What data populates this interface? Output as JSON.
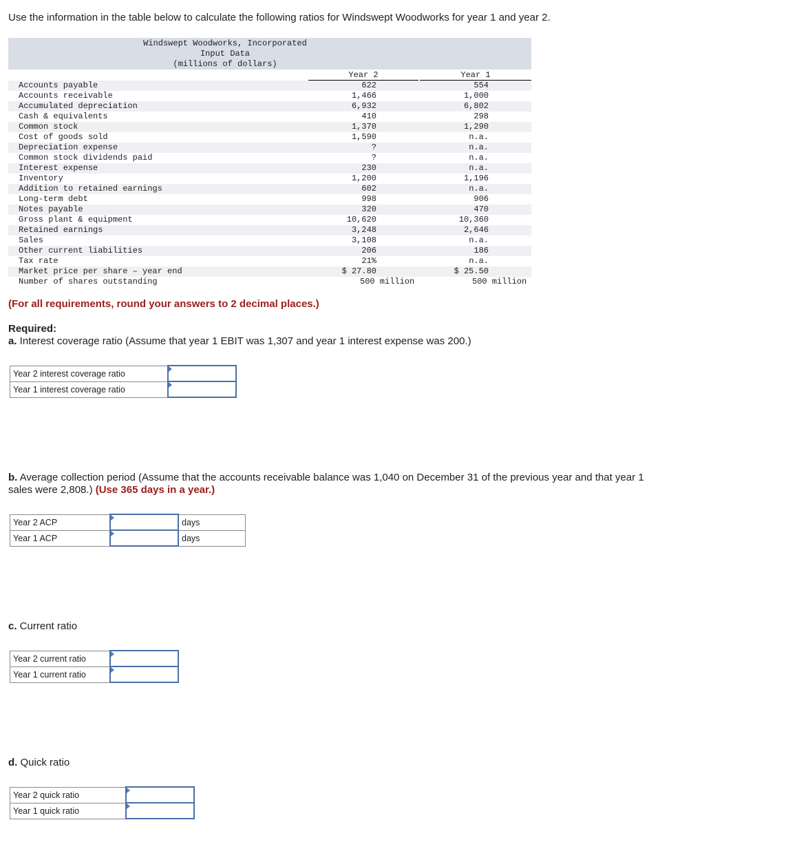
{
  "intro": "Use the information in the table below to calculate the following ratios for Windswept Woodworks for year 1 and year 2.",
  "table": {
    "title1": "Windswept Woodworks, Incorporated",
    "title2": "Input Data",
    "title3": "(millions of dollars)",
    "col_year2": "Year 2",
    "col_year1": "Year 1",
    "rows": [
      {
        "label": "Accounts payable",
        "y2": "622",
        "y1": "554"
      },
      {
        "label": "Accounts receivable",
        "y2": "1,466",
        "y1": "1,000"
      },
      {
        "label": "Accumulated depreciation",
        "y2": "6,932",
        "y1": "6,802"
      },
      {
        "label": "Cash & equivalents",
        "y2": "410",
        "y1": "298"
      },
      {
        "label": "Common stock",
        "y2": "1,370",
        "y1": "1,290"
      },
      {
        "label": "Cost of goods sold",
        "y2": "1,590",
        "y1": "n.a."
      },
      {
        "label": "Depreciation expense",
        "y2": "?",
        "y1": "n.a."
      },
      {
        "label": "Common stock dividends paid",
        "y2": "?",
        "y1": "n.a."
      },
      {
        "label": "Interest expense",
        "y2": "230",
        "y1": "n.a."
      },
      {
        "label": "Inventory",
        "y2": "1,200",
        "y1": "1,196"
      },
      {
        "label": "Addition to retained earnings",
        "y2": "602",
        "y1": "n.a."
      },
      {
        "label": "Long-term debt",
        "y2": "998",
        "y1": "906"
      },
      {
        "label": "Notes payable",
        "y2": "320",
        "y1": "470"
      },
      {
        "label": "Gross plant & equipment",
        "y2": "10,620",
        "y1": "10,360"
      },
      {
        "label": "Retained earnings",
        "y2": "3,248",
        "y1": "2,646"
      },
      {
        "label": "Sales",
        "y2": "3,108",
        "y1": "n.a."
      },
      {
        "label": "Other current liabilities",
        "y2": "206",
        "y1": "186"
      },
      {
        "label": "Tax rate",
        "y2": "21%",
        "y1": "n.a."
      },
      {
        "label": "Market price per share – year end",
        "y2": "$ 27.80",
        "y1": "$ 25.50"
      },
      {
        "label": "Number of shares outstanding",
        "y2": "500 million",
        "y1": "500 million"
      }
    ]
  },
  "note": "(For all requirements, round your answers to 2 decimal places.)",
  "required_title": "Required:",
  "parts": {
    "a": {
      "letter": "a.",
      "text": " Interest coverage ratio (Assume that year 1 EBIT was 1,307 and year 1 interest expense was 200.)",
      "rows": [
        {
          "label": "Year 2 interest coverage ratio",
          "value": ""
        },
        {
          "label": "Year 1 interest coverage ratio",
          "value": ""
        }
      ]
    },
    "b": {
      "letter": "b.",
      "text": " Average collection period (Assume that the accounts receivable balance was 1,040 on December 31 of the previous year and that year 1 sales were 2,808.) ",
      "emphasis": "(Use 365 days in a year.)",
      "rows": [
        {
          "label": "Year 2 ACP",
          "value": "",
          "unit": "days"
        },
        {
          "label": "Year 1 ACP",
          "value": "",
          "unit": "days"
        }
      ]
    },
    "c": {
      "letter": "c.",
      "text": " Current ratio",
      "rows": [
        {
          "label": "Year 2 current ratio",
          "value": ""
        },
        {
          "label": "Year 1 current ratio",
          "value": ""
        }
      ]
    },
    "d": {
      "letter": "d.",
      "text": " Quick ratio",
      "rows": [
        {
          "label": "Year 2 quick ratio",
          "value": ""
        },
        {
          "label": "Year 1 quick ratio",
          "value": ""
        }
      ]
    }
  },
  "colors": {
    "header_bg": "#d9dde6",
    "stripe_bg": "#eef0f4",
    "emphasis_red": "#9b1d1d",
    "input_border": "#4a6fa5"
  }
}
